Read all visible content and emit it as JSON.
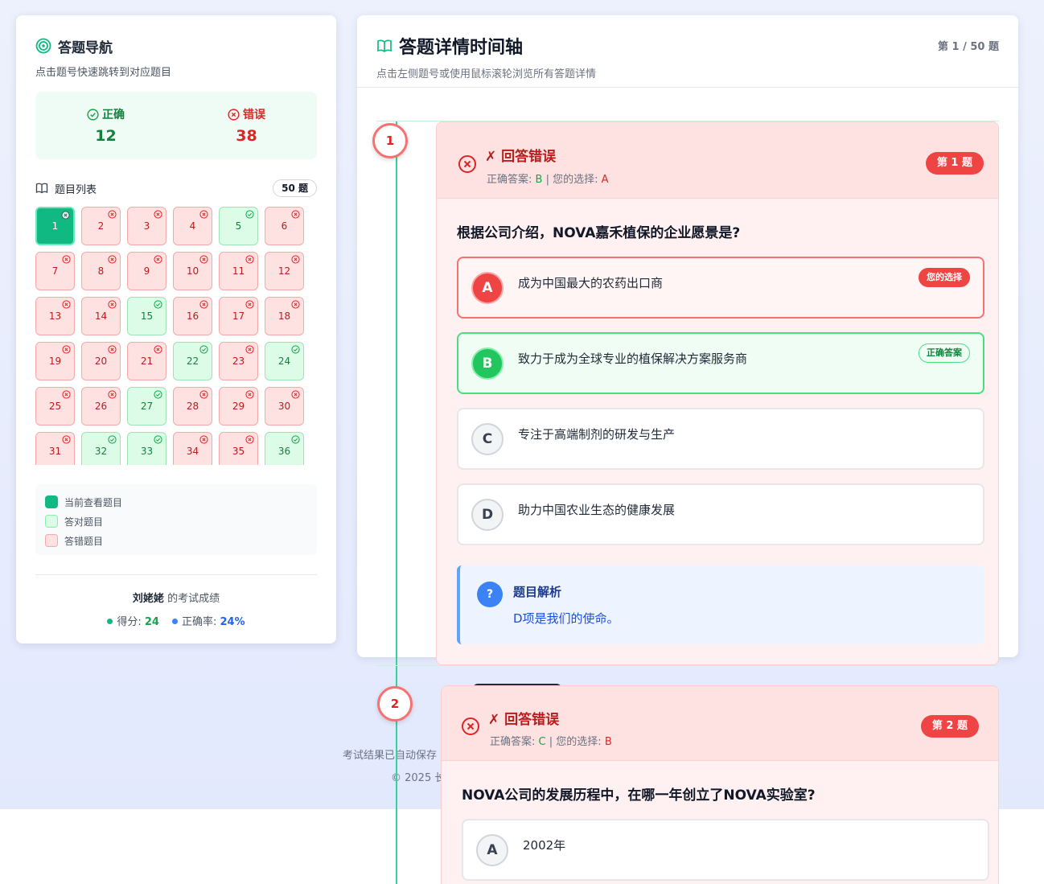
{
  "sidebar": {
    "title": "答题导航",
    "subtitle": "点击题号快速跳转到对应题目",
    "stats": {
      "correct_label": "正确",
      "correct_count": "12",
      "wrong_label": "错误",
      "wrong_count": "38"
    },
    "list_label": "题目列表",
    "list_count": "50 题",
    "questions": [
      {
        "n": "1",
        "s": "current"
      },
      {
        "n": "2",
        "s": "wrong"
      },
      {
        "n": "3",
        "s": "wrong"
      },
      {
        "n": "4",
        "s": "wrong"
      },
      {
        "n": "5",
        "s": "right"
      },
      {
        "n": "6",
        "s": "wrong"
      },
      {
        "n": "7",
        "s": "wrong"
      },
      {
        "n": "8",
        "s": "wrong"
      },
      {
        "n": "9",
        "s": "wrong"
      },
      {
        "n": "10",
        "s": "wrong"
      },
      {
        "n": "11",
        "s": "wrong"
      },
      {
        "n": "12",
        "s": "wrong"
      },
      {
        "n": "13",
        "s": "wrong"
      },
      {
        "n": "14",
        "s": "wrong"
      },
      {
        "n": "15",
        "s": "right"
      },
      {
        "n": "16",
        "s": "wrong"
      },
      {
        "n": "17",
        "s": "wrong"
      },
      {
        "n": "18",
        "s": "wrong"
      },
      {
        "n": "19",
        "s": "wrong"
      },
      {
        "n": "20",
        "s": "wrong"
      },
      {
        "n": "21",
        "s": "wrong"
      },
      {
        "n": "22",
        "s": "right"
      },
      {
        "n": "23",
        "s": "wrong"
      },
      {
        "n": "24",
        "s": "right"
      },
      {
        "n": "25",
        "s": "wrong"
      },
      {
        "n": "26",
        "s": "wrong"
      },
      {
        "n": "27",
        "s": "right"
      },
      {
        "n": "28",
        "s": "wrong"
      },
      {
        "n": "29",
        "s": "wrong"
      },
      {
        "n": "30",
        "s": "wrong"
      },
      {
        "n": "31",
        "s": "wrong"
      },
      {
        "n": "32",
        "s": "right"
      },
      {
        "n": "33",
        "s": "right"
      },
      {
        "n": "34",
        "s": "wrong"
      },
      {
        "n": "35",
        "s": "wrong"
      },
      {
        "n": "36",
        "s": "right"
      }
    ],
    "legend": {
      "current": "当前查看题目",
      "right": "答对题目",
      "wrong": "答错题目"
    },
    "score": {
      "name": "刘姥姥",
      "suffix": "的考试成绩",
      "score_label": "得分:",
      "score_value": "24",
      "rate_label": "正确率:",
      "rate_value": "24%"
    }
  },
  "main": {
    "title": "答题详情时间轴",
    "subtitle": "点击左侧题号或使用鼠标滚轮浏览所有答题详情",
    "page_indicator": "第 1 / 50 题"
  },
  "footer": {
    "note": "考试结果已自动保存",
    "copyright": "© 2025 长"
  },
  "timeline": {
    "q1": {
      "node": "1",
      "status": "✗ 回答错误",
      "correct_label": "正确答案:",
      "correct_value": "B",
      "sep": "|",
      "yours_label": "您的选择:",
      "yours_value": "A",
      "badge": "第 1 题",
      "question": "根据公司介绍，NOVA嘉禾植保的企业愿景是?",
      "options": [
        {
          "letter": "A",
          "text": "成为中国最大的农药出口商",
          "tag": "您的选择"
        },
        {
          "letter": "B",
          "text": "致力于成为全球专业的植保解决方案服务商",
          "tag": "正确答案"
        },
        {
          "letter": "C",
          "text": "专注于高端制剂的研发与生产"
        },
        {
          "letter": "D",
          "text": "助力中国农业生态的健康发展"
        }
      ],
      "explain_icon": "?",
      "explain_title": "题目解析",
      "explain_text": "D项是我们的使命。"
    },
    "q2": {
      "node": "2",
      "status": "✗ 回答错误",
      "correct_label": "正确答案:",
      "correct_value": "C",
      "sep": "|",
      "yours_label": "您的选择:",
      "yours_value": "B",
      "badge": "第 2 题",
      "question": "NOVA公司的发展历程中，在哪一年创立了NOVA实验室?",
      "options": [
        {
          "letter": "A",
          "text": "2002年"
        }
      ]
    }
  },
  "colors": {
    "accent": "#10b981",
    "correct": "#16a34a",
    "wrong": "#dc2626",
    "info": "#3b82f6"
  }
}
